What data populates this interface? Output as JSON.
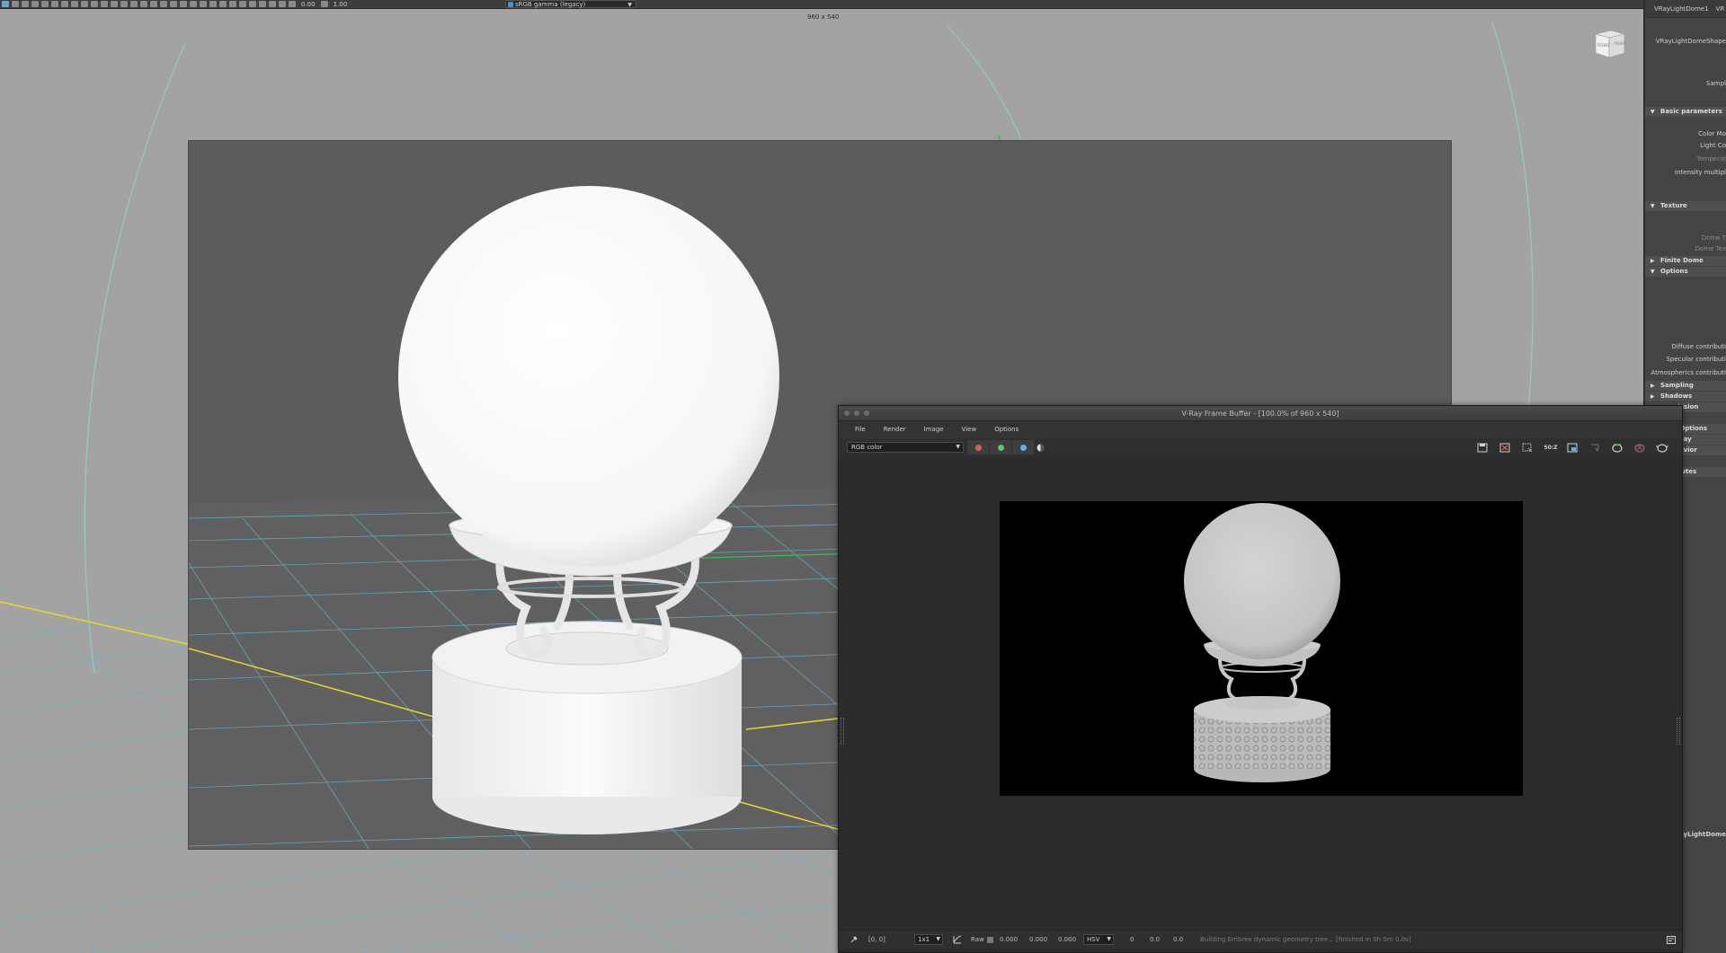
{
  "toolbar": {
    "value_a": "0.00",
    "value_b": "1.00",
    "color_space": "sRGB gamma (legacy)"
  },
  "viewport": {
    "resolution_label": "960 x 540",
    "viewcube_front": "FRONT",
    "viewcube_right": "RIGHT"
  },
  "attribute_editor": {
    "tabs": [
      "VRayLightDome1",
      "VR"
    ],
    "node_name": "VRayLightDomeShape",
    "rows": [
      {
        "text": "Sampl",
        "dim": false
      },
      {
        "text": "Color Mo",
        "dim": false
      },
      {
        "text": "Light Co",
        "dim": false
      },
      {
        "text": "Temperat",
        "dim": true
      },
      {
        "text": "Intensity multipl",
        "dim": false
      },
      {
        "text": "Dome T",
        "dim": true
      },
      {
        "text": "Dome Tex",
        "dim": true
      },
      {
        "text": "Diffuse contributi",
        "dim": false
      },
      {
        "text": "Specular contributi",
        "dim": false
      },
      {
        "text": "Atmospherics contributi",
        "dim": false
      }
    ],
    "sections": [
      {
        "label": "Basic parameters",
        "open": true
      },
      {
        "label": "Texture",
        "open": true
      },
      {
        "label": "Finite Dome",
        "open": false
      },
      {
        "label": "Options",
        "open": true
      },
      {
        "label": "Sampling",
        "open": false
      },
      {
        "label": "Shadows",
        "open": false
      },
      {
        "label": "n emission",
        "open": false
      },
      {
        "label": "nced Options",
        "open": false
      },
      {
        "label": "t Display",
        "open": false
      },
      {
        "label": "t Behavior",
        "open": false
      },
      {
        "label": "Attributes",
        "open": false
      }
    ],
    "footer_label": "RayLightDome"
  },
  "vfb": {
    "title": "V-Ray Frame Buffer - [100.0% of 960 x 540]",
    "menus": [
      "File",
      "Render",
      "Image",
      "View",
      "Options"
    ],
    "channel": "RGB color",
    "colors": {
      "red": "#e05a5a",
      "green": "#5ec76a",
      "blue": "#5ab4e6"
    },
    "icons": [
      "save-image-icon",
      "clear-image-icon",
      "region-render-icon",
      "compare-icon",
      "frame-icon",
      "track-mouse-icon",
      "render-icon",
      "stop-render-icon",
      "teapot-render-icon"
    ],
    "compare_label": "50:Z",
    "status": {
      "coords": "[0, 0]",
      "zoom": "1x1",
      "raw_label": "Raw",
      "r": "0.000",
      "g": "0.000",
      "b": "0.000",
      "color_mode": "HSV",
      "h": "0",
      "s": "0.0",
      "v": "0.0",
      "message": "Building Embree dynamic geometry tree... [finished in 0h 0m 0.0s]"
    }
  }
}
